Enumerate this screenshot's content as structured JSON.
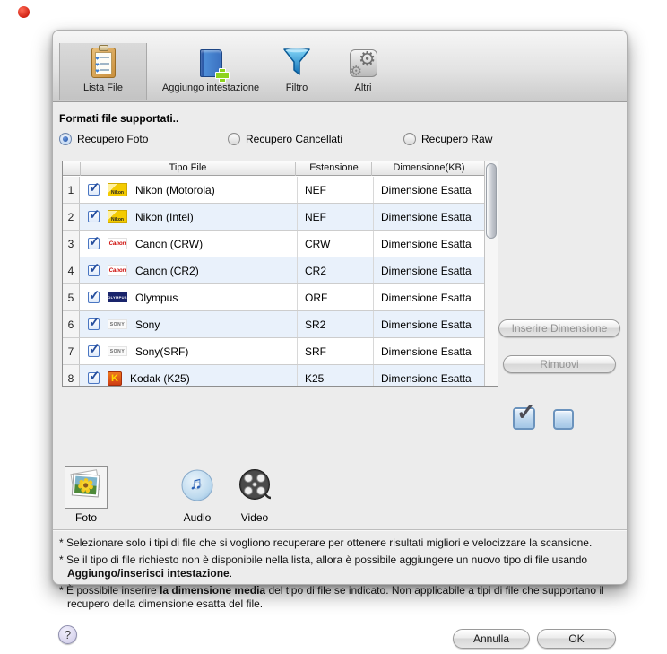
{
  "window": {
    "toolbar": {
      "items": [
        {
          "label": "Lista File",
          "icon": "clipboard-icon",
          "selected": true
        },
        {
          "label": "Aggiungo intestazione",
          "icon": "book-add-icon",
          "selected": false
        },
        {
          "label": "Filtro",
          "icon": "funnel-icon",
          "selected": false
        },
        {
          "label": "Altri",
          "icon": "gears-icon",
          "selected": false
        }
      ]
    },
    "section_title": "Formati file supportati..",
    "radios": [
      {
        "label": "Recupero Foto",
        "selected": true
      },
      {
        "label": "Recupero Cancellati",
        "selected": false
      },
      {
        "label": "Recupero Raw",
        "selected": false
      }
    ],
    "table": {
      "headers": {
        "tipo": "Tipo File",
        "est": "Estensione",
        "dim": "Dimensione(KB)"
      },
      "rows": [
        {
          "num": "1",
          "checked": true,
          "brand": "Nikon",
          "name": "Nikon (Motorola)",
          "ext": "NEF",
          "size": "Dimensione Esatta"
        },
        {
          "num": "2",
          "checked": true,
          "brand": "Nikon",
          "name": "Nikon (Intel)",
          "ext": "NEF",
          "size": "Dimensione Esatta"
        },
        {
          "num": "3",
          "checked": true,
          "brand": "Canon",
          "name": "Canon (CRW)",
          "ext": "CRW",
          "size": "Dimensione Esatta"
        },
        {
          "num": "4",
          "checked": true,
          "brand": "Canon",
          "name": "Canon (CR2)",
          "ext": "CR2",
          "size": "Dimensione Esatta"
        },
        {
          "num": "5",
          "checked": true,
          "brand": "OLYMPUS",
          "name": "Olympus",
          "ext": "ORF",
          "size": "Dimensione Esatta"
        },
        {
          "num": "6",
          "checked": true,
          "brand": "SONY",
          "name": "Sony",
          "ext": "SR2",
          "size": "Dimensione Esatta"
        },
        {
          "num": "7",
          "checked": true,
          "brand": "SONY",
          "name": "Sony(SRF)",
          "ext": "SRF",
          "size": "Dimensione Esatta"
        },
        {
          "num": "8",
          "checked": true,
          "brand": "K",
          "name": "Kodak (K25)",
          "ext": "K25",
          "size": "Dimensione Esatta"
        }
      ]
    },
    "side_buttons": {
      "insert": "Inserire Dimensione",
      "remove": "Rimuovi"
    },
    "media_tabs": [
      {
        "label": "Foto",
        "selected": true
      },
      {
        "label": "Audio",
        "selected": false
      },
      {
        "label": "Video",
        "selected": false
      }
    ],
    "footnotes": [
      {
        "star": "*",
        "t1": "Selezionare solo i tipi di file che si vogliono recuperare per ottenere risultati migliori e velocizzare la scansione.",
        "b1": "",
        "t2": ""
      },
      {
        "star": "*",
        "t1": "Se il tipo di file richiesto non è disponibile nella lista, allora è possibile aggiungere un nuovo tipo di file usando ",
        "b1": "Aggiungo/inserisci intestazione",
        "t2": "."
      },
      {
        "star": "*",
        "t1": "È possibile inserire ",
        "b1": "la dimensione media",
        "t2": " del tipo di file se indicato. Non applicabile a tipi di file che supportano il recupero della dimensione esatta del file."
      }
    ],
    "footer": {
      "help": "?",
      "cancel": "Annulla",
      "ok": "OK"
    },
    "colors": {
      "row_stripe": "#e9f1fb",
      "checkbox_blue": "#4a76c2",
      "window_bg": "#ececec"
    }
  }
}
